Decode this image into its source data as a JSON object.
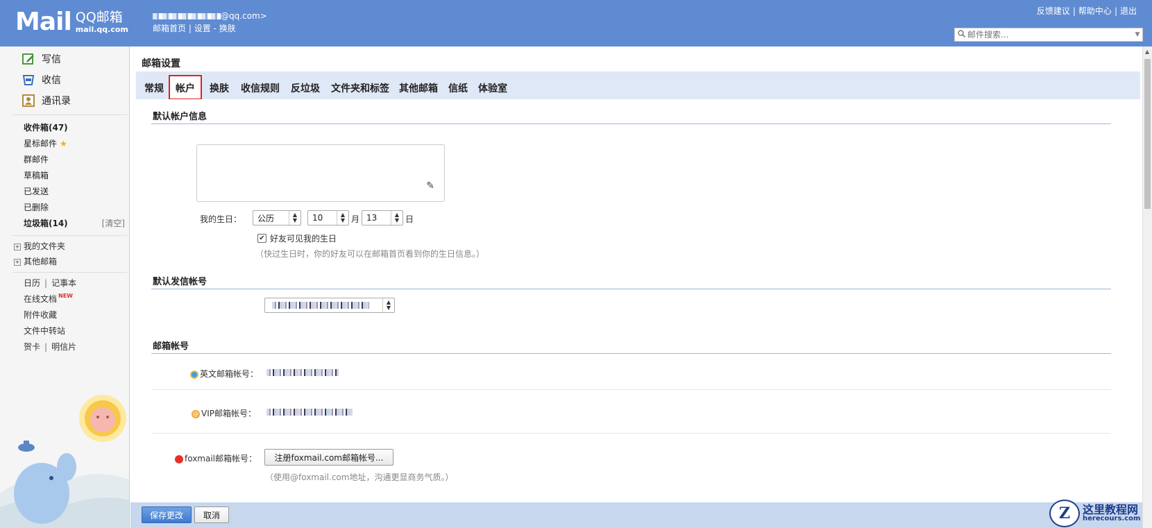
{
  "header": {
    "logo_text": "Mail",
    "brand": "QQ邮箱",
    "domain": "mail.qq.com",
    "account_suffix": "@qq.com>",
    "nav": {
      "home": "邮箱首页",
      "sep": "|",
      "settings": "设置",
      "dash": "-",
      "skin": "换肤"
    },
    "links": {
      "feedback": "反馈建议",
      "help": "帮助中心",
      "logout": "退出"
    },
    "search_placeholder": "邮件搜索..."
  },
  "sidebar": {
    "actions": {
      "compose": "写信",
      "inbox": "收信",
      "contacts": "通讯录"
    },
    "folders": {
      "inbox": "收件箱(47)",
      "starred": "星标邮件",
      "group": "群邮件",
      "drafts": "草稿箱",
      "sent": "已发送",
      "deleted": "已删除",
      "spam": "垃圾箱(14)",
      "clear": "[清空]"
    },
    "trees": {
      "my_folders": "我的文件夹",
      "other_mail": "其他邮箱"
    },
    "tools": {
      "calendar": "日历",
      "notes": "记事本",
      "docs": "在线文档",
      "new_badge": "NEW",
      "attachments": "附件收藏",
      "transfer": "文件中转站",
      "cards": "贺卡",
      "postcards": "明信片"
    }
  },
  "main": {
    "title": "邮箱设置",
    "tabs": [
      "常规",
      "帐户",
      "换肤",
      "收信规则",
      "反垃圾",
      "文件夹和标签",
      "其他邮箱",
      "信纸",
      "体验室"
    ],
    "active_tab": "帐户",
    "sections": {
      "account_info": {
        "title": "默认帐户信息",
        "birthday_label": "我的生日：",
        "calendar_type": "公历",
        "month": "10",
        "month_unit": "月",
        "day": "13",
        "day_unit": "日",
        "show_birthday": "好友可见我的生日",
        "birthday_hint": "（快过生日时，你的好友可以在邮箱首页看到你的生日信息。）"
      },
      "default_sender": {
        "title": "默认发信帐号"
      },
      "mail_accounts": {
        "title": "邮箱帐号",
        "english_label": "英文邮箱帐号：",
        "vip_label": "VIP邮箱帐号：",
        "foxmail_label": "foxmail邮箱帐号：",
        "foxmail_button": "注册foxmail.com邮箱帐号...",
        "foxmail_hint": "（使用@foxmail.com地址，沟通更显商务气质。）"
      }
    },
    "footer": {
      "save": "保存更改",
      "cancel": "取消"
    }
  },
  "watermark": {
    "cn": "这里教程网",
    "en": "herecours.com",
    "logo_letter": "Z"
  },
  "colors": {
    "header_bg": "#5f8bd2",
    "tabbar_bg": "#dfe8f6",
    "active_tab_border": "#e02020",
    "primary_button": "#3f79cf"
  }
}
